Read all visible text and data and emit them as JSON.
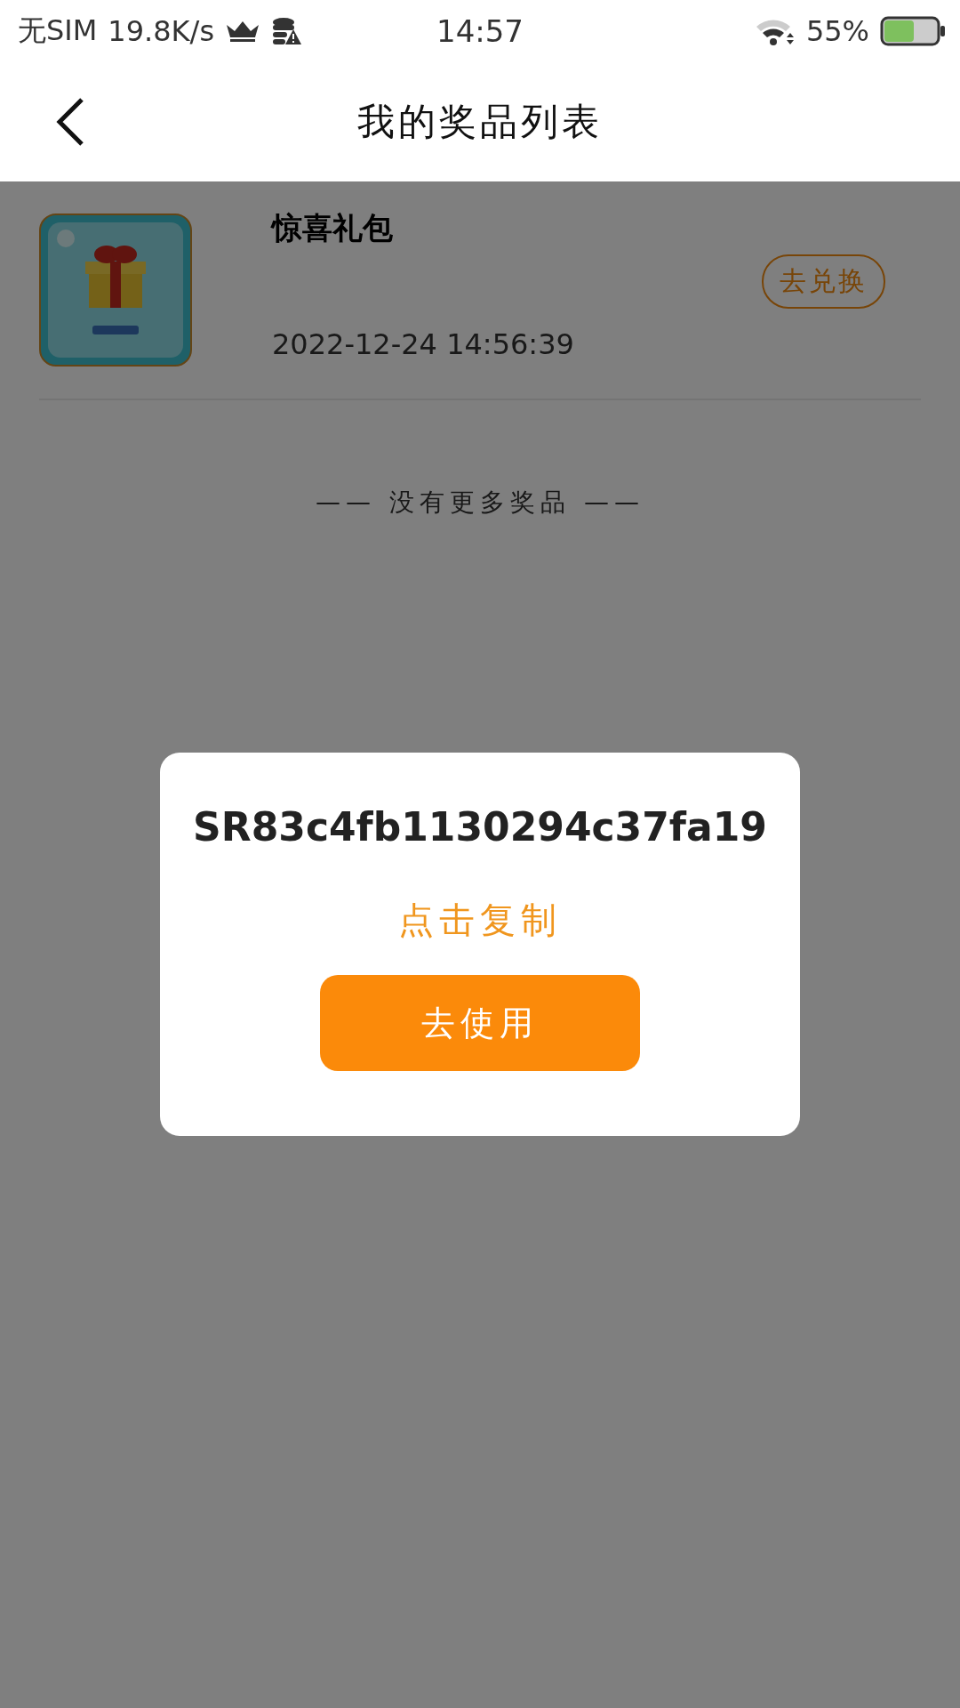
{
  "status_bar": {
    "carrier": "无SIM",
    "speed": "19.8K/s",
    "time": "14:57",
    "battery": "55%"
  },
  "header": {
    "title": "我的奖品列表"
  },
  "prizes": [
    {
      "name": "惊喜礼包",
      "time": "2022-12-24 14:56:39",
      "action": "去兑换"
    }
  ],
  "list_end": "—— 没有更多奖品 ——",
  "dialog": {
    "code": "SR83c4fb1130294c37fa19",
    "copy_label": "点击复制",
    "button": "去使用"
  }
}
